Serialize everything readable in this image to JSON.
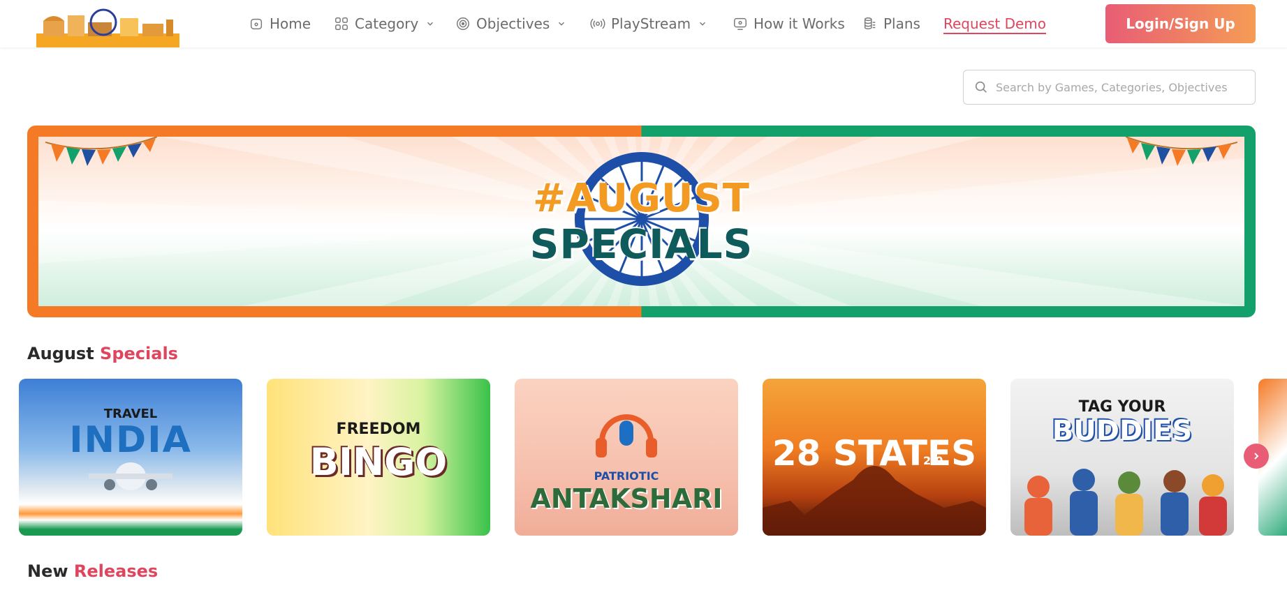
{
  "nav": {
    "home": "Home",
    "category": "Category",
    "objectives": "Objectives",
    "playstream": "PlayStream",
    "how_it_works": "How it Works",
    "plans": "Plans",
    "request_demo": "Request Demo",
    "login": "Login/Sign Up"
  },
  "search": {
    "placeholder": "Search by Games, Categories, Objectives"
  },
  "banner": {
    "line1": "#AUGUST",
    "line2": "SPECIALS"
  },
  "sections": {
    "august_specials": {
      "part1": "August",
      "part2": "Specials"
    },
    "new_releases": {
      "part1": "New",
      "part2": "Releases"
    }
  },
  "cards": [
    {
      "name": "Travel India",
      "line1": "TRAVEL",
      "line2": "INDIA"
    },
    {
      "name": "Freedom Bingo",
      "line1": "FREEDOM",
      "line2": "BINGO"
    },
    {
      "name": "Patriotic Antakshari",
      "line1": "PATRIOTIC",
      "line2": "ANTAKSHARI"
    },
    {
      "name": "28 States 2.0",
      "line1": "28 STATES",
      "line2": "2.0"
    },
    {
      "name": "Tag Your Buddies",
      "line1": "TAG YOUR",
      "line2": "BUDDIES"
    }
  ],
  "colors": {
    "accent": "#e0455e",
    "saffron": "#f47a26",
    "green": "#14a06b"
  }
}
